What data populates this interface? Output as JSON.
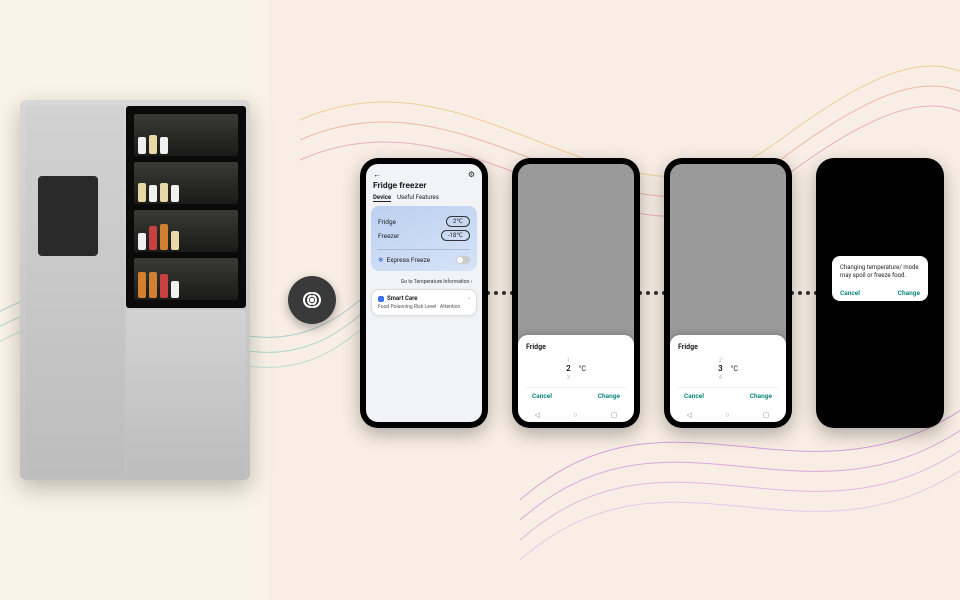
{
  "appliance": {
    "name": "LG InstaView Refrigerator"
  },
  "wifi_icon": "wireless-icon",
  "screen1": {
    "title": "Fridge freezer",
    "tab_active": "Device",
    "tab_inactive": "Useful Features",
    "row_fridge_label": "Fridge",
    "row_fridge_value": "2℃",
    "row_freezer_label": "Freezer",
    "row_freezer_value": "-18℃",
    "express_label": "Express Freeze",
    "temp_link": "Go to Temperature Information ›",
    "care_title": "Smart Care",
    "care_sub": "Food Poisoning Risk Level · Attention"
  },
  "screen2": {
    "sheet_title": "Fridge",
    "spin_prev": "1",
    "spin_sel": "2",
    "spin_next": "3",
    "unit": "°C",
    "cancel": "Cancel",
    "change": "Change"
  },
  "screen3": {
    "sheet_title": "Fridge",
    "spin_prev": "2",
    "spin_sel": "3",
    "spin_next": "4",
    "unit": "°C",
    "cancel": "Cancel",
    "change": "Change"
  },
  "screen4": {
    "message": "Changing temperature/ mode may spoil or freeze food.",
    "cancel": "Cancel",
    "change": "Change"
  }
}
